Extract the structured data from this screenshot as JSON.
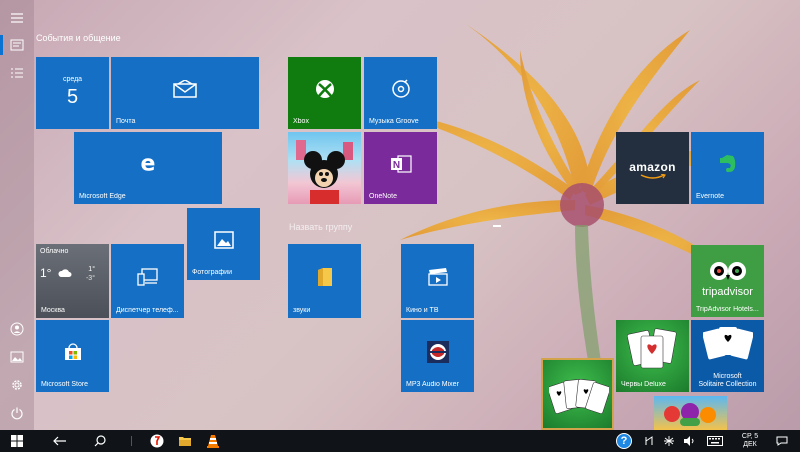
{
  "groups": {
    "events": "События и общение",
    "name_group": "Назвать группу"
  },
  "tiles": {
    "calendar": {
      "day": "среда",
      "date": "5"
    },
    "mail": "Почта",
    "edge": "Microsoft Edge",
    "photos": "Фотографии",
    "weather": {
      "condition": "Облачно",
      "temp": "1°",
      "high": "1°",
      "low": "-3°",
      "city": "Москва"
    },
    "devices": "Диспетчер телеф...",
    "store": "Microsoft Store",
    "xbox": "Xbox",
    "groove": "Музыка Groove",
    "onenote": "OneNote",
    "sounds": "звуки",
    "movies": "Кино и ТВ",
    "mp3mixer": "MP3 Audio Mixer",
    "amazon": "amazon",
    "evernote": "Evernote",
    "tripadvisor_logo": "tripadvisor",
    "tripadvisor": "TripAdvisor Hotels...",
    "hearts": "Червы Deluxe",
    "solitaire": "Microsoft\nSolitaire Collection"
  },
  "taskbar": {
    "date_line1": "СР, 5",
    "date_line2": "ДЕК",
    "help": "?"
  },
  "colors": {
    "tile_blue": "#1570c5",
    "xbox_green": "#107c10",
    "onenote_purple": "#7a2a9a",
    "amazon_dark": "#232f3e",
    "store_blue": "#1570c5"
  }
}
